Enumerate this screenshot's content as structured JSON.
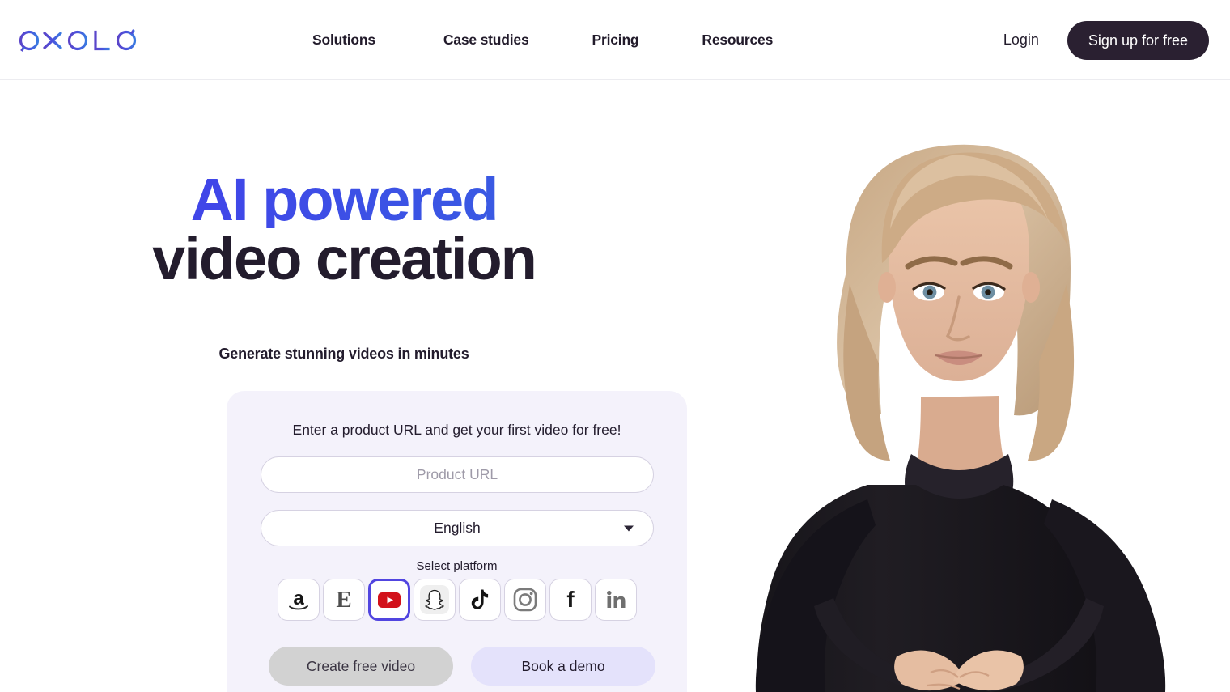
{
  "header": {
    "logo_text": "OXOLO",
    "logo_icon": "oxolo-wordmark-logo",
    "nav": [
      {
        "label": "Solutions"
      },
      {
        "label": "Case studies"
      },
      {
        "label": "Pricing"
      },
      {
        "label": "Resources"
      }
    ],
    "login_label": "Login",
    "signup_label": "Sign up for free",
    "signup_bg": "#2a2031"
  },
  "hero": {
    "headline_line1": "AI powered",
    "headline_line2": "video creation",
    "headline_accent_color": "#4046e8",
    "headline_dark_color": "#231c2d",
    "subheadline": "Generate stunning videos in minutes"
  },
  "form": {
    "title": "Enter a product URL and get your first video for free!",
    "url_value": "",
    "url_placeholder": "Product URL",
    "language_selected": "English",
    "language_caret_icon": "chevron-down-icon",
    "platform_label": "Select platform",
    "card_bg": "#f4f2fb",
    "selected_platform": "youtube",
    "selection_color": "#5145e0",
    "platforms": [
      {
        "name": "amazon",
        "label": "Amazon",
        "icon": "amazon-icon",
        "selected": false
      },
      {
        "name": "etsy",
        "label": "Etsy",
        "icon": "etsy-icon",
        "selected": false
      },
      {
        "name": "youtube",
        "label": "YouTube",
        "icon": "youtube-icon",
        "selected": true
      },
      {
        "name": "snapchat",
        "label": "Snapchat",
        "icon": "snapchat-icon",
        "selected": false
      },
      {
        "name": "tiktok",
        "label": "TikTok",
        "icon": "tiktok-icon",
        "selected": false
      },
      {
        "name": "instagram",
        "label": "Instagram",
        "icon": "instagram-icon",
        "selected": false
      },
      {
        "name": "facebook",
        "label": "Facebook",
        "icon": "facebook-icon",
        "selected": false
      },
      {
        "name": "linkedin",
        "label": "LinkedIn",
        "icon": "linkedin-icon",
        "selected": false
      }
    ],
    "create_label": "Create free video",
    "create_bg": "#d2d2d2",
    "demo_label": "Book a demo",
    "demo_bg": "#e4e2fb"
  },
  "hero_image": {
    "description": "AI presenter avatar: blonde woman in black turtleneck, hands clasped",
    "name": "hero-avatar-image"
  }
}
